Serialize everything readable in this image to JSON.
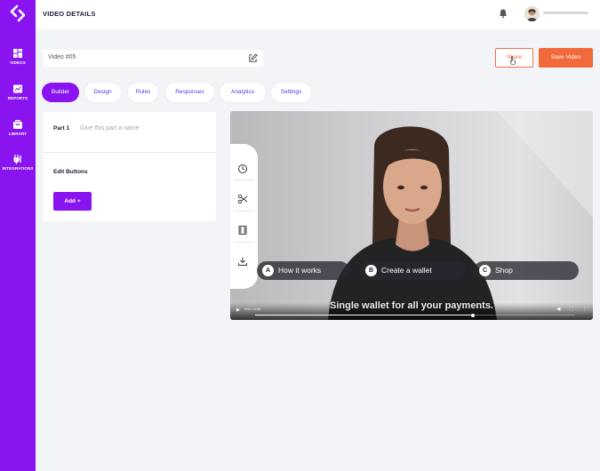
{
  "app": {
    "page_title": "VIDEO DETAILS"
  },
  "sidebar": {
    "items": [
      {
        "label": "VIDEOS",
        "icon": "grid-icon"
      },
      {
        "label": "REPORTS",
        "icon": "reports-icon"
      },
      {
        "label": "LIBRARY",
        "icon": "library-icon"
      },
      {
        "label": "INTEGRATIONS",
        "icon": "integrations-icon"
      }
    ]
  },
  "video_title": {
    "value": "Video #05"
  },
  "actions": {
    "share_label": "Share",
    "save_label": "Save Video"
  },
  "tabs": [
    {
      "label": "Builder",
      "active": true
    },
    {
      "label": "Design"
    },
    {
      "label": "Rules"
    },
    {
      "label": "Responses"
    },
    {
      "label": "Analytics"
    },
    {
      "label": "Settings"
    }
  ],
  "part": {
    "label": "Part 1",
    "placeholder": "Give this part a name"
  },
  "edit_buttons": {
    "heading": "Edit Buttons",
    "add_label": "Add +"
  },
  "video": {
    "choices": [
      {
        "letter": "A",
        "label": "How it works"
      },
      {
        "letter": "B",
        "label": "Create a wallet"
      },
      {
        "letter": "C",
        "label": "Shop"
      }
    ],
    "subtitle": "Single wallet for all your payments.",
    "time": "0:01 / 0:30",
    "progress": 0.68
  },
  "colors": {
    "accent": "#8a14f0",
    "orange": "#f26a3b"
  }
}
